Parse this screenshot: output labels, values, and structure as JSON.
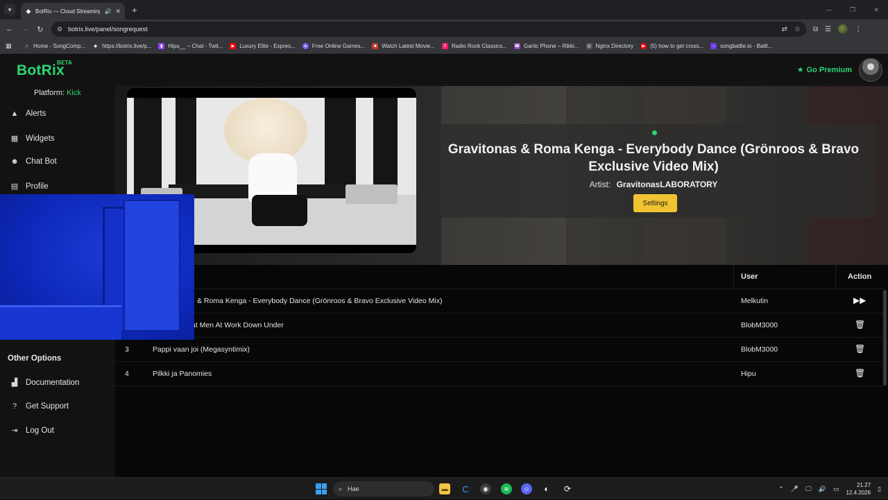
{
  "browser": {
    "tab_title": "BotRix — Cloud Streaming B",
    "url": "botrix.live/panel/songrequest",
    "bookmarks": [
      {
        "label": "Home - SongComp...",
        "color": "#3a3a3a"
      },
      {
        "label": "https://botrix.live/p...",
        "color": "#3a3a3a"
      },
      {
        "label": "Hipu__ – Chat - Twit...",
        "color": "#9146ff"
      },
      {
        "label": "Luxury Elite - Expres...",
        "color": "#ff0000"
      },
      {
        "label": "Free Online Games...",
        "color": "#7b5cff"
      },
      {
        "label": "Watch Latest Movie...",
        "color": "#c0392b"
      },
      {
        "label": "Radio Rock Classics...",
        "color": "#e91e63"
      },
      {
        "label": "Gartic Phone – Rikki...",
        "color": "#8e44ad"
      },
      {
        "label": "Nginx Directory",
        "color": "#555555"
      },
      {
        "label": "(5) how to get cross...",
        "color": "#ff0000"
      },
      {
        "label": "songbattle.io - Battl...",
        "color": "#6a3de8"
      }
    ]
  },
  "app": {
    "brand": "BotRix",
    "brand_badge": "BETA",
    "go_premium": "Go Premium",
    "accent": "#2ed573"
  },
  "sidebar": {
    "platform_label": "Platform:",
    "platform_value": "Kick",
    "items": [
      {
        "label": "Alerts",
        "icon": "warning-icon"
      },
      {
        "label": "Widgets",
        "icon": "grid-icon"
      },
      {
        "label": "Chat Bot",
        "icon": "robot-icon"
      },
      {
        "label": "Profile",
        "icon": "id-card-icon"
      }
    ],
    "other_title": "Other Options",
    "other_items": [
      {
        "label": "Documentation",
        "icon": "document-icon"
      },
      {
        "label": "Get Support",
        "icon": "question-icon"
      },
      {
        "label": "Log Out",
        "icon": "logout-icon"
      }
    ]
  },
  "now_playing": {
    "title": "Gravitonas & Roma Kenga - Everybody Dance (Grönroos & Bravo Exclusive Video Mix)",
    "artist_label": "Artist:",
    "artist": "GravitonasLABORATORY",
    "settings_label": "Settings"
  },
  "queue": {
    "headers": {
      "user": "User",
      "action": "Action"
    },
    "rows": [
      {
        "num": "",
        "song": "& Roma Kenga - Everybody Dance (Grönroos & Bravo Exclusive Video Mix)",
        "user": "Melkutin",
        "action": "skip-icon"
      },
      {
        "num": "",
        "song": "at Men At Work Down Under",
        "user": "BlobM3000",
        "action": "trash-icon"
      },
      {
        "num": "3",
        "song": "Pappi vaan joi (Megasyntimix)",
        "user": "BlobM3000",
        "action": "trash-icon"
      },
      {
        "num": "4",
        "song": "Pilkki ja Panomies",
        "user": "Hipu",
        "action": "trash-icon"
      }
    ]
  },
  "taskbar": {
    "search_placeholder": "Hae",
    "time": "21.27",
    "date": "12.4.2026"
  }
}
